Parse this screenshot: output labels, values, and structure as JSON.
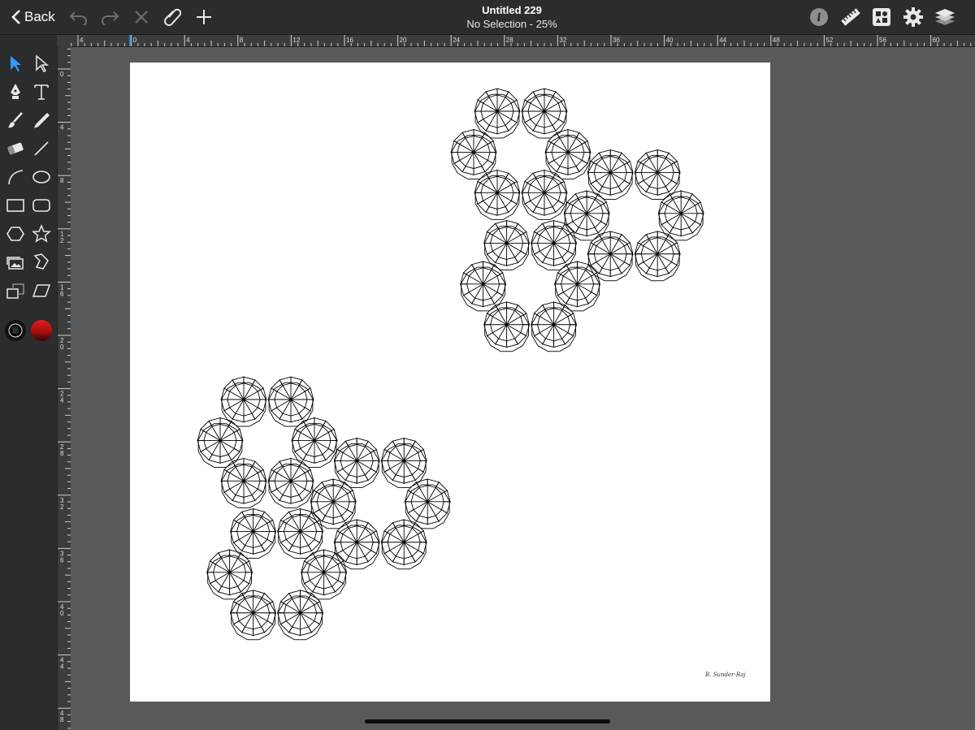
{
  "toolbar": {
    "back_label": "Back",
    "title": "Untitled 229",
    "subtitle": "No Selection - 25%",
    "left_icons": [
      "undo-icon",
      "redo-icon",
      "delete-icon",
      "attach-icon",
      "add-icon"
    ],
    "right_icons": [
      "info-icon",
      "ruler-icon",
      "library-icon",
      "gear-icon",
      "layers-icon"
    ]
  },
  "rulers": {
    "horizontal_labels": [
      "4",
      "0",
      "4",
      "8",
      "12",
      "16",
      "20",
      "24",
      "28",
      "32",
      "36",
      "40",
      "44",
      "48",
      "52",
      "56",
      "60"
    ],
    "vertical_labels": [
      "0",
      "4",
      "8",
      "1 2",
      "1 6",
      "2 0",
      "2 4",
      "2 8",
      "3 2",
      "3 6",
      "4 0",
      "4 4",
      "4 8"
    ]
  },
  "tools": [
    "select-arrow-icon",
    "direct-select-icon",
    "pen-icon",
    "text-icon",
    "brush-icon",
    "pencil-icon",
    "eraser-icon",
    "line-icon",
    "arc-icon",
    "ellipse-icon",
    "rectangle-icon",
    "rounded-rectangle-icon",
    "hexagon-icon",
    "star-icon",
    "image-icon",
    "transform-icon",
    "frame-icon",
    "skew-icon"
  ],
  "colors": {
    "accent": "#2f9bff",
    "stroke": "#000000",
    "fill": "#b01010"
  },
  "canvas": {
    "signature": "R. Sunder-Raj"
  }
}
